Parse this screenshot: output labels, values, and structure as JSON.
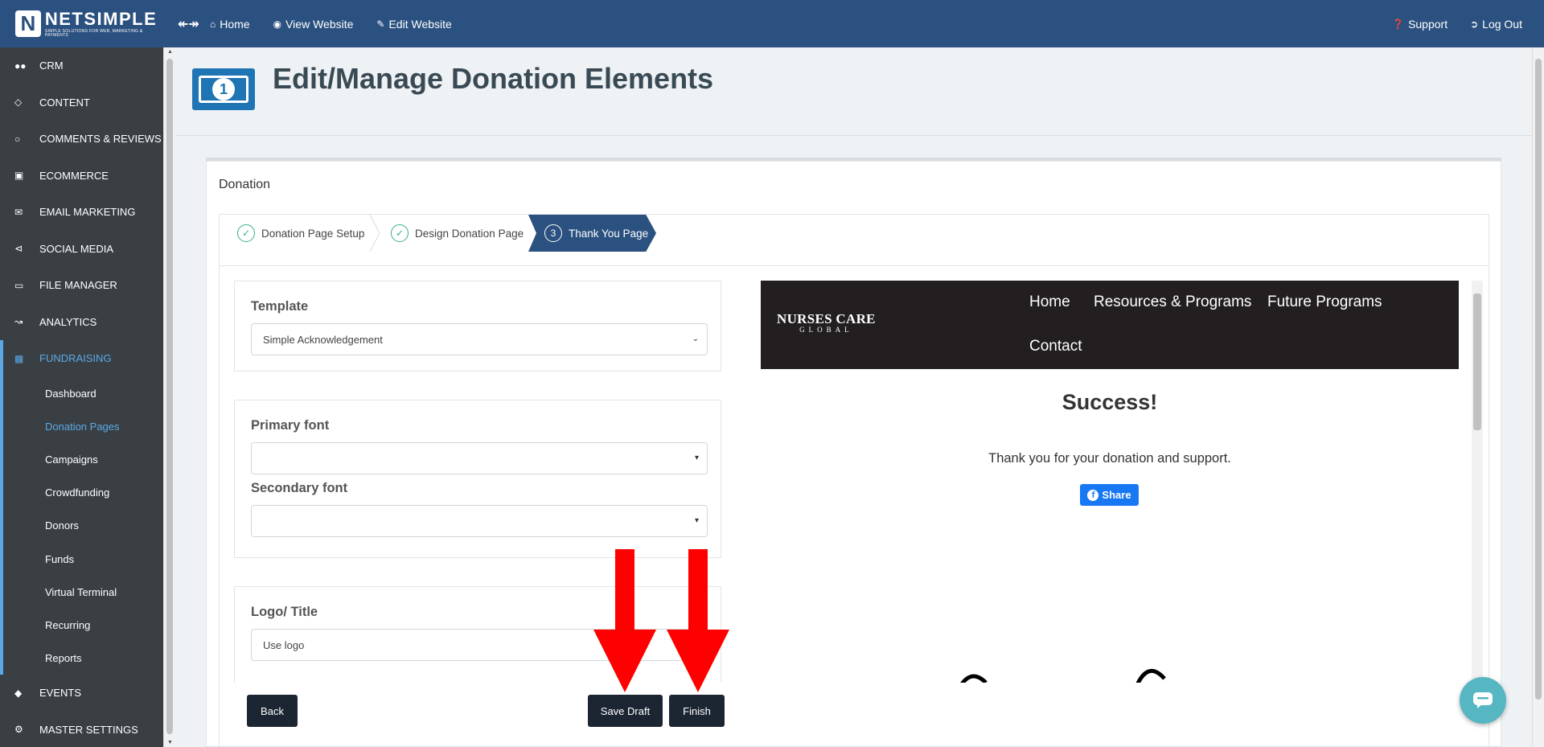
{
  "brand": {
    "name": "NETSIMPLE",
    "tagline": "SIMPLE SOLUTIONS FOR WEB, MARKETING & PAYMENTS"
  },
  "topnav": {
    "home": "Home",
    "view_website": "View Website",
    "edit_website": "Edit Website",
    "support": "Support",
    "logout": "Log Out"
  },
  "sidebar": {
    "items": [
      {
        "label": "CRM",
        "icon": "users-icon"
      },
      {
        "label": "CONTENT",
        "icon": "diamond-icon"
      },
      {
        "label": "COMMENTS & REVIEWS",
        "icon": "comment-icon"
      },
      {
        "label": "ECOMMERCE",
        "icon": "gift-icon"
      },
      {
        "label": "EMAIL MARKETING",
        "icon": "envelope-icon"
      },
      {
        "label": "SOCIAL MEDIA",
        "icon": "share-icon"
      },
      {
        "label": "FILE MANAGER",
        "icon": "folder-icon"
      },
      {
        "label": "ANALYTICS",
        "icon": "chart-line-icon"
      },
      {
        "label": "FUNDRAISING",
        "icon": "money-icon"
      }
    ],
    "sub_items": [
      "Dashboard",
      "Donation Pages",
      "Campaigns",
      "Crowdfunding",
      "Donors",
      "Funds",
      "Virtual Terminal",
      "Recurring",
      "Reports"
    ],
    "bottom_items": [
      {
        "label": "EVENTS",
        "icon": "ticket-icon"
      },
      {
        "label": "MASTER SETTINGS",
        "icon": "gear-icon"
      }
    ]
  },
  "page": {
    "title": "Edit/Manage Donation Elements",
    "icon_digit": "1",
    "card_title": "Donation"
  },
  "steps": [
    {
      "label": "Donation Page Setup",
      "state": "done"
    },
    {
      "label": "Design Donation Page",
      "state": "done"
    },
    {
      "label": "Thank You Page",
      "state": "active",
      "number": "3"
    }
  ],
  "form": {
    "template_label": "Template",
    "template_value": "Simple Acknowledgement",
    "primary_font_label": "Primary font",
    "primary_font_value": "",
    "secondary_font_label": "Secondary font",
    "secondary_font_value": "",
    "logo_title_label": "Logo/ Title",
    "logo_title_value": "Use logo"
  },
  "buttons": {
    "back": "Back",
    "save_draft": "Save Draft",
    "finish": "Finish"
  },
  "preview": {
    "logo_line1": "NURSES CARE",
    "logo_line2": "GLOBAL",
    "nav": [
      "Home",
      "Resources & Programs",
      "Future Programs",
      "Contact"
    ],
    "heading": "Success!",
    "message": "Thank you for your donation and support.",
    "share_label": "Share"
  },
  "colors": {
    "topbar": "#2b5180",
    "sidebar": "#3a3f44",
    "accent": "#5aa9e6",
    "active_step": "#2b5180",
    "arrow": "#ff0000",
    "button": "#1b2632",
    "facebook": "#1877f2"
  }
}
